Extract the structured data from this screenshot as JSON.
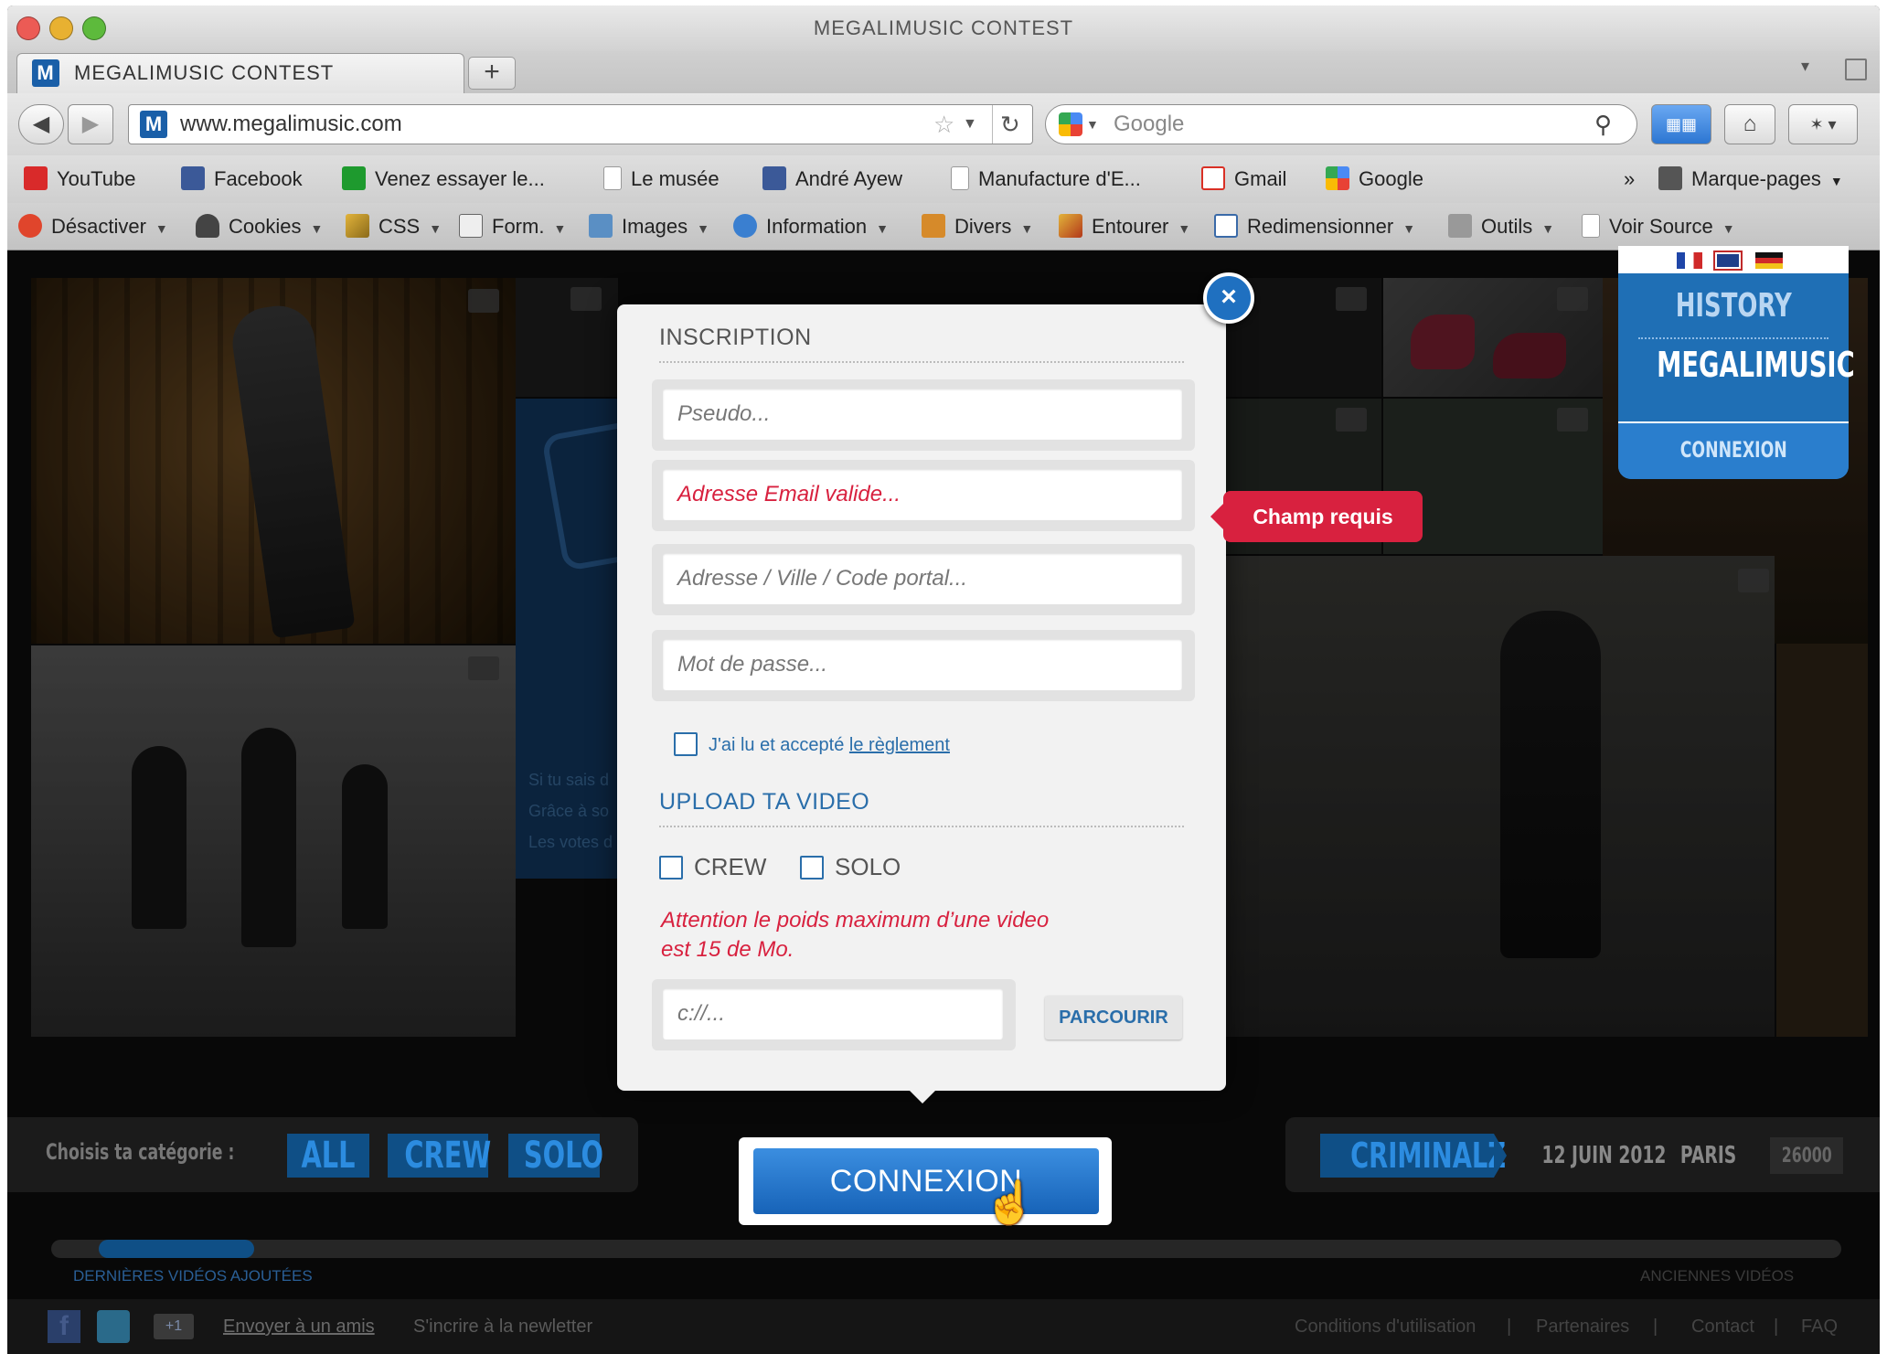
{
  "window": {
    "title": "MEGALIMUSIC CONTEST"
  },
  "tab": {
    "title": "MEGALIMUSIC CONTEST",
    "favicon": "M",
    "new_tab": "+"
  },
  "nav": {
    "url": "www.megalimusic.com",
    "search_placeholder": "Google"
  },
  "bookmarks": [
    {
      "label": "YouTube",
      "icon": "youtube-icon",
      "color": "#d92a2a"
    },
    {
      "label": "Facebook",
      "icon": "facebook-icon",
      "color": "#3b5998"
    },
    {
      "label": "Venez essayer le...",
      "icon": "green-flag-icon",
      "color": "#1e9a2e"
    },
    {
      "label": "Le musée",
      "icon": "page-icon",
      "color": "#ffffff"
    },
    {
      "label": "André Ayew",
      "icon": "facebook-icon",
      "color": "#3b5998"
    },
    {
      "label": "Manufacture d'E...",
      "icon": "page-icon",
      "color": "#ffffff"
    },
    {
      "label": "Gmail",
      "icon": "gmail-icon",
      "color": "#d93025"
    },
    {
      "label": "Google",
      "icon": "google-icon",
      "color": "#4a8af4"
    }
  ],
  "bookmarks_more": "»",
  "bookmarks_menu": "Marque-pages",
  "devtools": [
    {
      "label": "Désactiver",
      "icon": "disable-icon"
    },
    {
      "label": "Cookies",
      "icon": "person-icon"
    },
    {
      "label": "CSS",
      "icon": "pencil-icon"
    },
    {
      "label": "Form.",
      "icon": "form-icon"
    },
    {
      "label": "Images",
      "icon": "image-icon"
    },
    {
      "label": "Information",
      "icon": "info-icon"
    },
    {
      "label": "Divers",
      "icon": "toolbox-icon"
    },
    {
      "label": "Entourer",
      "icon": "pen-icon"
    },
    {
      "label": "Redimensionner",
      "icon": "resize-icon"
    },
    {
      "label": "Outils",
      "icon": "tools-icon"
    }
  ],
  "devtools_source": "Voir Source",
  "modal": {
    "close": "×",
    "inscription_title": "INSCRIPTION",
    "fields": [
      {
        "placeholder": "Pseudo...",
        "error": false
      },
      {
        "placeholder": "Adresse Email valide...",
        "error": true
      },
      {
        "placeholder": "Adresse / Ville / Code portal...",
        "error": false
      },
      {
        "placeholder": "Mot de passe...",
        "error": false
      }
    ],
    "terms_text": "J'ai lu et accepté ",
    "terms_link": "le règlement",
    "upload_title": "UPLOAD TA VIDEO",
    "crew": "CREW",
    "solo": "SOLO",
    "warning_line1": "Attention le poids maximum d’une video",
    "warning_line2": "est 15 de Mo.",
    "file_placeholder": "c://...",
    "browse": "PARCOURIR"
  },
  "tooltip": "Champ requis",
  "history_badge": {
    "line1": "HISTORY",
    "line2": "MEGALIMUSIC",
    "login": "CONNEXION"
  },
  "bg_text": [
    "Si tu sais d",
    "Grâce à so",
    "Les votes d"
  ],
  "category": {
    "label": "Choisis ta catégorie :",
    "all": "ALL",
    "crew": "CREW",
    "solo": "SOLO"
  },
  "event": {
    "name": "CRIMINALZ",
    "date": "12 JUIN 2012",
    "city": "PARIS",
    "count": "26000"
  },
  "connexion_button": "CONNEXION",
  "scroll": {
    "left": "DERNIÈRES VIDÉOS AJOUTÉES",
    "right": "ANCIENNES VIDÉOS"
  },
  "footer": {
    "send_friend": "Envoyer à un amis",
    "newsletter": "S'incrire à la newletter",
    "links": [
      "Conditions d'utilisation",
      "Partenaires",
      "Contact",
      "FAQ"
    ],
    "gplus": "+1"
  },
  "colors": {
    "accent": "#1f70c0",
    "error": "#d8213f",
    "link": "#2a6eaa"
  }
}
